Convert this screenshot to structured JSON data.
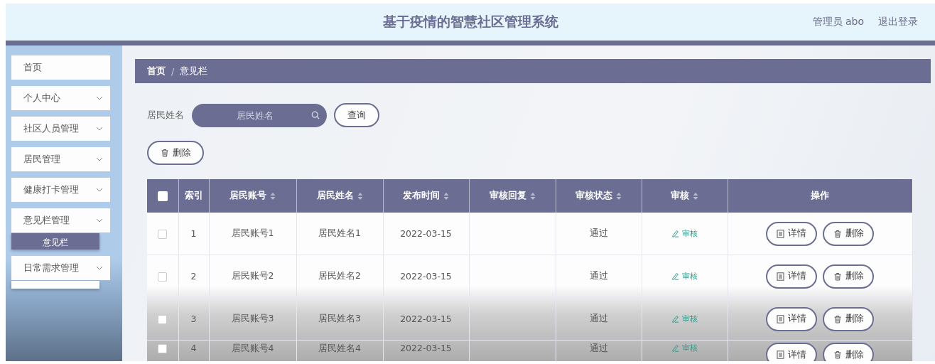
{
  "header": {
    "title": "基于疫情的智慧社区管理系统",
    "user": "管理员 abo",
    "logout": "退出登录"
  },
  "sidebar": {
    "items": [
      {
        "label": "首页",
        "kind": "link",
        "expanded": false
      },
      {
        "label": "个人中心",
        "kind": "menu",
        "expanded": false
      },
      {
        "label": "社区人员管理",
        "kind": "menu",
        "expanded": false
      },
      {
        "label": "居民管理",
        "kind": "menu",
        "expanded": false
      },
      {
        "label": "健康打卡管理",
        "kind": "menu",
        "expanded": false
      },
      {
        "label": "意见栏管理",
        "kind": "menu",
        "expanded": true,
        "children": [
          {
            "label": "意见栏",
            "selected": true
          }
        ]
      },
      {
        "label": "日常需求管理",
        "kind": "menu",
        "expanded": true
      }
    ]
  },
  "breadcrumb": {
    "items": [
      "首页",
      "意见栏"
    ],
    "separator": "/"
  },
  "search": {
    "label": "居民姓名",
    "placeholder": "居民姓名",
    "button": "查询"
  },
  "toolbar": {
    "delete_button": "删除"
  },
  "table": {
    "header_checkbox": {
      "checked": false
    },
    "columns": [
      {
        "kind": "checkbox"
      },
      {
        "kind": "text",
        "label": "索引",
        "sortable": false
      },
      {
        "kind": "text",
        "label": "居民账号",
        "sortable": true
      },
      {
        "kind": "text",
        "label": "居民姓名",
        "sortable": true
      },
      {
        "kind": "text",
        "label": "发布时间",
        "sortable": true
      },
      {
        "kind": "text",
        "label": "审核回复",
        "sortable": true
      },
      {
        "kind": "text",
        "label": "审核状态",
        "sortable": true
      },
      {
        "kind": "text",
        "label": "审核",
        "sortable": true
      },
      {
        "kind": "text",
        "label": "操作",
        "sortable": false
      }
    ],
    "rows": [
      {
        "checked": false,
        "index": "1",
        "account": "居民账号1",
        "name": "居民姓名1",
        "time": "2022-03-15",
        "status": "通过",
        "review": "审核",
        "actions": [
          {
            "kind": "detail",
            "label": "详情"
          },
          {
            "kind": "delete",
            "label": "删除"
          }
        ]
      },
      {
        "checked": false,
        "index": "2",
        "account": "居民账号2",
        "name": "居民姓名2",
        "time": "2022-03-15",
        "status": "通过",
        "review": "审核",
        "actions": [
          {
            "kind": "detail",
            "label": "详情"
          },
          {
            "kind": "delete",
            "label": "删除"
          }
        ]
      },
      {
        "checked": false,
        "index": "3",
        "account": "居民账号3",
        "name": "居民姓名3",
        "time": "2022-03-15",
        "status": "通过",
        "review": "审核",
        "actions": [
          {
            "kind": "detail",
            "label": "详情"
          },
          {
            "kind": "delete",
            "label": "删除"
          }
        ]
      },
      {
        "checked": false,
        "index": "4",
        "account": "居民账号4",
        "name": "居民姓名4",
        "time": "2022-03-15",
        "status": "通过",
        "review": "审核",
        "actions": [
          {
            "kind": "detail",
            "label": "详情"
          },
          {
            "kind": "delete",
            "label": "删除"
          }
        ]
      }
    ]
  }
}
